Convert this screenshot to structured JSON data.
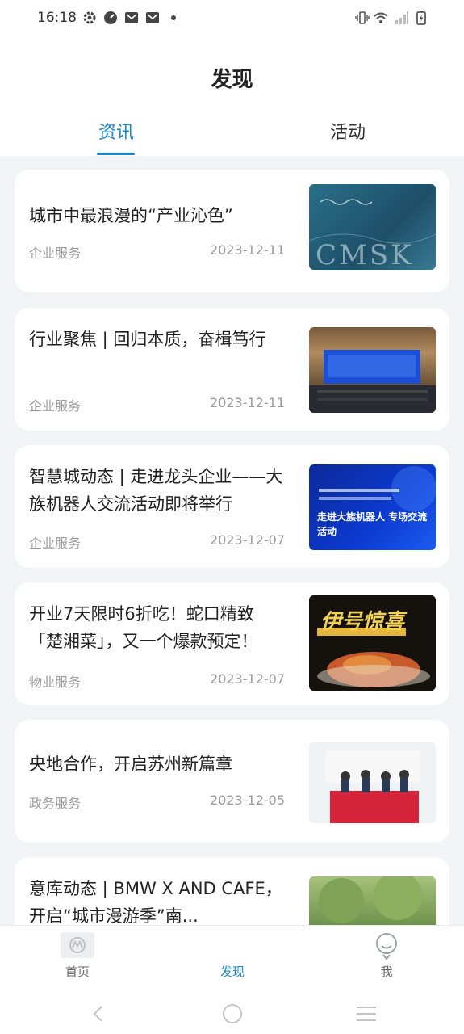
{
  "status": {
    "time": "16:18",
    "icons": [
      "settings-icon",
      "clock-icon",
      "mail-icon",
      "mail-icon",
      "dot-icon",
      "vibrate-icon",
      "wifi-icon",
      "signal-icon",
      "battery-charging-icon"
    ]
  },
  "header": {
    "title": "发现"
  },
  "tabs": [
    {
      "label": "资讯",
      "active": true
    },
    {
      "label": "活动",
      "active": false
    }
  ],
  "news": [
    {
      "title": "城市中最浪漫的“产业沁色”",
      "category": "企业服务",
      "date": "2023-12-11",
      "thumb_text": "CMSK"
    },
    {
      "title": "行业聚焦 | 回归本质，奋楫笃行",
      "category": "企业服务",
      "date": "2023-12-11",
      "thumb_text": ""
    },
    {
      "title": "智慧城动态 | 走进龙头企业——大族机器人交流活动即将举行",
      "category": "企业服务",
      "date": "2023-12-07",
      "thumb_text": "走进大族机器人 专场交流活动"
    },
    {
      "title": "开业7天限时6折吃！蛇口精致「楚湘菜」，又一个爆款预定！",
      "category": "物业服务",
      "date": "2023-12-07",
      "thumb_text": "伊号惊喜"
    },
    {
      "title": "央地合作，开启苏州新篇章",
      "category": "政务服务",
      "date": "2023-12-05",
      "thumb_text": ""
    },
    {
      "title": "意库动态 | BMW X AND CAFE，开启“城市漫游季”南...",
      "category": "",
      "date": "",
      "thumb_text": ""
    }
  ],
  "bottom_nav": [
    {
      "label": "首页",
      "icon": "home-logo-icon",
      "active": false
    },
    {
      "label": "发现",
      "icon": "discover-icon",
      "active": true
    },
    {
      "label": "我",
      "icon": "profile-icon",
      "active": false
    }
  ],
  "system_nav": [
    "back-icon",
    "home-circle-icon",
    "menu-icon"
  ],
  "colors": {
    "accent": "#1f86c7",
    "background": "#f2f3f5",
    "muted_text": "#9a9a9a"
  }
}
